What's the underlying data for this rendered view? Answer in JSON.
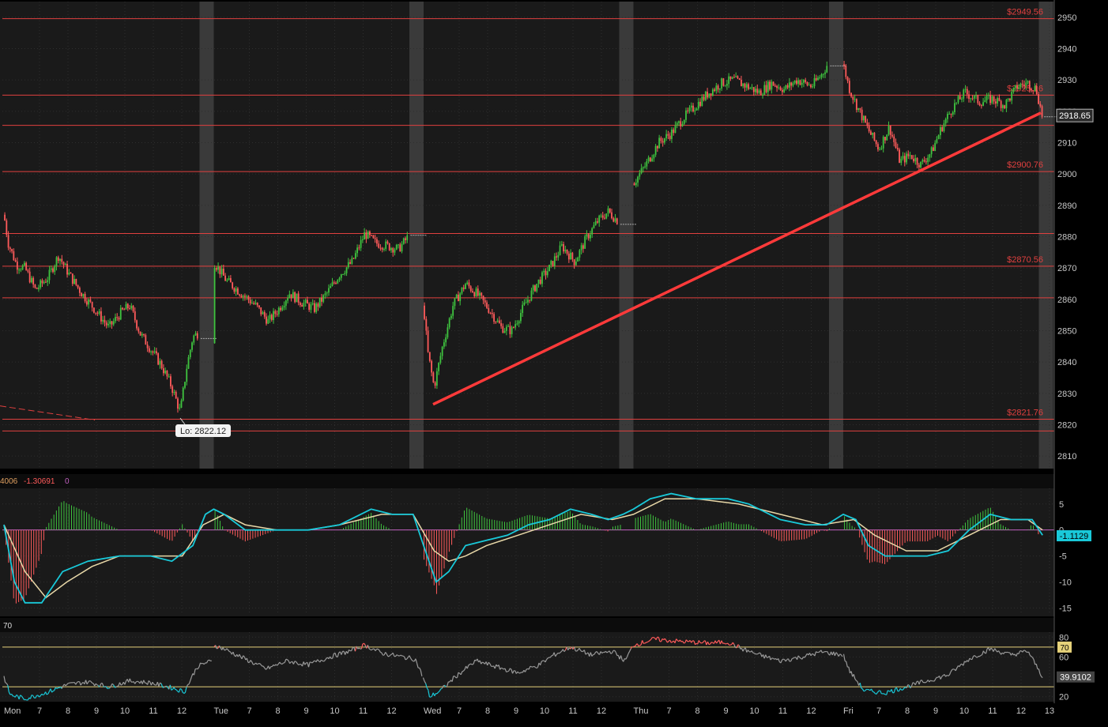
{
  "colors": {
    "background": "#000000",
    "panel": "#1a1a1a",
    "grid": "#2e2e2e",
    "session_shade": "#3a3a3a",
    "up_candle": "#3fc43f",
    "down_candle": "#ff5b5b",
    "level_line": "#e0403f",
    "trendline": "#ff3a3a",
    "axis_text": "#c8c8c8",
    "macd_fast": "#19c9d9",
    "macd_slow": "#e8d8a8",
    "rsi_line": "#9a9a9a",
    "rsi_hot": "#ff5b5b",
    "rsi_cold": "#19c9d9",
    "rsi_band": "#e6d27a"
  },
  "chart_data": [
    {
      "type": "candlestick",
      "panel": "price",
      "ylim": [
        2806,
        2955
      ],
      "y_ticks": [
        2810,
        2820,
        2830,
        2840,
        2850,
        2860,
        2870,
        2880,
        2890,
        2900,
        2910,
        2920,
        2930,
        2940,
        2950
      ],
      "last_price": "2918.65",
      "sessions": [
        {
          "day": "Mon",
          "hours": [
            "7",
            "8",
            "9",
            "10",
            "11",
            "12"
          ]
        },
        {
          "day": "Tue",
          "hours": [
            "7",
            "8",
            "9",
            "10",
            "11",
            "12"
          ]
        },
        {
          "day": "Wed",
          "hours": [
            "7",
            "8",
            "9",
            "10",
            "11",
            "12"
          ]
        },
        {
          "day": "Thu",
          "hours": [
            "7",
            "8",
            "9",
            "10",
            "11",
            "12"
          ]
        },
        {
          "day": "Fri",
          "hours": [
            "7",
            "8",
            "9",
            "10",
            "11",
            "12",
            "13"
          ]
        }
      ],
      "levels": [
        {
          "value": 2949.56,
          "label": "$2949.56"
        },
        {
          "value": 2925.16,
          "label": "$2925.16"
        },
        {
          "value": 2915.5,
          "label": ""
        },
        {
          "value": 2900.76,
          "label": "$2900.76"
        },
        {
          "value": 2881.0,
          "label": ""
        },
        {
          "value": 2870.56,
          "label": "$2870.56"
        },
        {
          "value": 2860.5,
          "label": ""
        },
        {
          "value": 2821.76,
          "label": "$2821.76"
        },
        {
          "value": 2818.0,
          "label": ""
        }
      ],
      "annotation": {
        "label": "Lo: 2822.12",
        "value": 2822.12
      },
      "trendline": {
        "from": {
          "session": "Wed",
          "value": 2826.5
        },
        "to": {
          "session": "Fri",
          "value": 2919.5
        }
      },
      "price_path": [
        [
          0,
          2887
        ],
        [
          0.02,
          2878
        ],
        [
          0.06,
          2871
        ],
        [
          0.1,
          2870
        ],
        [
          0.15,
          2863
        ],
        [
          0.21,
          2867
        ],
        [
          0.26,
          2874
        ],
        [
          0.31,
          2868
        ],
        [
          0.37,
          2862
        ],
        [
          0.43,
          2857
        ],
        [
          0.5,
          2851
        ],
        [
          0.56,
          2856
        ],
        [
          0.6,
          2858
        ],
        [
          0.65,
          2849
        ],
        [
          0.7,
          2844
        ],
        [
          0.75,
          2839
        ],
        [
          0.8,
          2832
        ],
        [
          0.84,
          2824
        ],
        [
          0.87,
          2838
        ],
        [
          0.9,
          2848
        ],
        [
          0.94,
          2850
        ],
        [
          1.0,
          2846
        ],
        [
          1.0,
          2872
        ],
        [
          1.06,
          2866
        ],
        [
          1.13,
          2862
        ],
        [
          1.2,
          2858
        ],
        [
          1.26,
          2853
        ],
        [
          1.31,
          2857
        ],
        [
          1.36,
          2862
        ],
        [
          1.42,
          2859
        ],
        [
          1.48,
          2857
        ],
        [
          1.54,
          2862
        ],
        [
          1.6,
          2868
        ],
        [
          1.66,
          2872
        ],
        [
          1.72,
          2881
        ],
        [
          1.77,
          2878
        ],
        [
          1.83,
          2877
        ],
        [
          1.88,
          2876
        ],
        [
          1.95,
          2882
        ],
        [
          2.0,
          2858
        ],
        [
          2.02,
          2843
        ],
        [
          2.05,
          2832
        ],
        [
          2.09,
          2845
        ],
        [
          2.14,
          2858
        ],
        [
          2.2,
          2865
        ],
        [
          2.25,
          2862
        ],
        [
          2.31,
          2857
        ],
        [
          2.37,
          2851
        ],
        [
          2.42,
          2850
        ],
        [
          2.48,
          2858
        ],
        [
          2.54,
          2865
        ],
        [
          2.6,
          2870
        ],
        [
          2.66,
          2877
        ],
        [
          2.72,
          2872
        ],
        [
          2.78,
          2880
        ],
        [
          2.83,
          2885
        ],
        [
          2.88,
          2888
        ],
        [
          2.94,
          2884
        ],
        [
          3.0,
          2897
        ],
        [
          3.06,
          2903
        ],
        [
          3.12,
          2910
        ],
        [
          3.18,
          2913
        ],
        [
          3.24,
          2918
        ],
        [
          3.3,
          2922
        ],
        [
          3.36,
          2926
        ],
        [
          3.42,
          2929
        ],
        [
          3.48,
          2930
        ],
        [
          3.54,
          2928
        ],
        [
          3.6,
          2926
        ],
        [
          3.66,
          2929
        ],
        [
          3.72,
          2927
        ],
        [
          3.78,
          2930
        ],
        [
          3.85,
          2928
        ],
        [
          3.9,
          2932
        ],
        [
          3.95,
          2938
        ],
        [
          4.0,
          2935
        ],
        [
          4.03,
          2927
        ],
        [
          4.07,
          2921
        ],
        [
          4.12,
          2914
        ],
        [
          4.17,
          2908
        ],
        [
          4.22,
          2915
        ],
        [
          4.27,
          2904
        ],
        [
          4.32,
          2906
        ],
        [
          4.37,
          2903
        ],
        [
          4.42,
          2907
        ],
        [
          4.47,
          2915
        ],
        [
          4.52,
          2921
        ],
        [
          4.58,
          2926
        ],
        [
          4.65,
          2923
        ],
        [
          4.71,
          2924
        ],
        [
          4.77,
          2922
        ],
        [
          4.83,
          2928
        ],
        [
          4.88,
          2929
        ],
        [
          4.92,
          2927
        ],
        [
          4.95,
          2918
        ]
      ]
    },
    {
      "type": "line",
      "panel": "macd",
      "header_values": [
        "4006",
        "-1.30691",
        "0"
      ],
      "ylim": [
        -16,
        8
      ],
      "y_ticks": [
        5,
        0,
        -5,
        -10,
        -15
      ],
      "last_value": "-1.1129",
      "fast": [
        [
          0,
          1
        ],
        [
          0.05,
          -10
        ],
        [
          0.1,
          -14
        ],
        [
          0.18,
          -14
        ],
        [
          0.28,
          -8
        ],
        [
          0.4,
          -6
        ],
        [
          0.55,
          -5
        ],
        [
          0.7,
          -5
        ],
        [
          0.8,
          -6
        ],
        [
          0.9,
          -3
        ],
        [
          0.96,
          3
        ],
        [
          1.0,
          4
        ],
        [
          1.05,
          3
        ],
        [
          1.15,
          0
        ],
        [
          1.3,
          0
        ],
        [
          1.45,
          0
        ],
        [
          1.6,
          1
        ],
        [
          1.75,
          4
        ],
        [
          1.85,
          3
        ],
        [
          1.95,
          3
        ],
        [
          2.0,
          -3
        ],
        [
          2.06,
          -10
        ],
        [
          2.12,
          -8
        ],
        [
          2.2,
          -3
        ],
        [
          2.3,
          -2
        ],
        [
          2.4,
          -1
        ],
        [
          2.5,
          1
        ],
        [
          2.6,
          2
        ],
        [
          2.7,
          4
        ],
        [
          2.8,
          3
        ],
        [
          2.88,
          2
        ],
        [
          2.95,
          3
        ],
        [
          3.0,
          4
        ],
        [
          3.08,
          6
        ],
        [
          3.18,
          7
        ],
        [
          3.3,
          6
        ],
        [
          3.45,
          6
        ],
        [
          3.55,
          5
        ],
        [
          3.7,
          2
        ],
        [
          3.82,
          1
        ],
        [
          3.92,
          1
        ],
        [
          4.0,
          3
        ],
        [
          4.06,
          2
        ],
        [
          4.12,
          -3
        ],
        [
          4.2,
          -5
        ],
        [
          4.3,
          -5
        ],
        [
          4.4,
          -5
        ],
        [
          4.5,
          -4
        ],
        [
          4.6,
          0
        ],
        [
          4.7,
          3
        ],
        [
          4.8,
          2
        ],
        [
          4.9,
          2
        ],
        [
          4.95,
          -1
        ]
      ],
      "slow": [
        [
          0,
          1
        ],
        [
          0.1,
          -8
        ],
        [
          0.2,
          -13
        ],
        [
          0.3,
          -10
        ],
        [
          0.42,
          -7
        ],
        [
          0.55,
          -5
        ],
        [
          0.7,
          -5
        ],
        [
          0.85,
          -5
        ],
        [
          0.95,
          1
        ],
        [
          1.05,
          3
        ],
        [
          1.15,
          1
        ],
        [
          1.3,
          0
        ],
        [
          1.45,
          0
        ],
        [
          1.6,
          1
        ],
        [
          1.8,
          3
        ],
        [
          1.95,
          3
        ],
        [
          2.05,
          -4
        ],
        [
          2.12,
          -6
        ],
        [
          2.2,
          -5
        ],
        [
          2.3,
          -3
        ],
        [
          2.45,
          -1
        ],
        [
          2.6,
          1
        ],
        [
          2.75,
          3
        ],
        [
          2.9,
          2
        ],
        [
          3.0,
          3
        ],
        [
          3.15,
          6
        ],
        [
          3.3,
          6
        ],
        [
          3.5,
          5
        ],
        [
          3.7,
          3
        ],
        [
          3.9,
          1
        ],
        [
          4.05,
          2
        ],
        [
          4.15,
          -1
        ],
        [
          4.3,
          -4
        ],
        [
          4.45,
          -4
        ],
        [
          4.6,
          -1
        ],
        [
          4.75,
          2
        ],
        [
          4.88,
          2
        ],
        [
          4.95,
          0
        ]
      ],
      "histogram_note": "green above zero, red below"
    },
    {
      "type": "line",
      "panel": "rsi",
      "header_values": [
        "70"
      ],
      "ylim": [
        15,
        85
      ],
      "y_ticks": [
        80,
        60,
        20
      ],
      "bands": [
        70,
        30
      ],
      "band_label": "70",
      "last_value": "39.9102",
      "values": [
        [
          0,
          40
        ],
        [
          0.03,
          22
        ],
        [
          0.1,
          18
        ],
        [
          0.2,
          24
        ],
        [
          0.3,
          32
        ],
        [
          0.4,
          35
        ],
        [
          0.5,
          30
        ],
        [
          0.6,
          36
        ],
        [
          0.7,
          34
        ],
        [
          0.8,
          29
        ],
        [
          0.86,
          25
        ],
        [
          0.92,
          50
        ],
        [
          0.97,
          55
        ],
        [
          1.0,
          55
        ],
        [
          1.0,
          72
        ],
        [
          1.05,
          68
        ],
        [
          1.15,
          58
        ],
        [
          1.25,
          48
        ],
        [
          1.35,
          56
        ],
        [
          1.45,
          52
        ],
        [
          1.55,
          60
        ],
        [
          1.65,
          66
        ],
        [
          1.72,
          72
        ],
        [
          1.8,
          64
        ],
        [
          1.9,
          60
        ],
        [
          1.96,
          58
        ],
        [
          2.0,
          38
        ],
        [
          2.03,
          20
        ],
        [
          2.08,
          26
        ],
        [
          2.15,
          40
        ],
        [
          2.25,
          56
        ],
        [
          2.35,
          50
        ],
        [
          2.45,
          44
        ],
        [
          2.55,
          52
        ],
        [
          2.62,
          62
        ],
        [
          2.7,
          70
        ],
        [
          2.8,
          62
        ],
        [
          2.9,
          66
        ],
        [
          2.96,
          56
        ],
        [
          3.0,
          72
        ],
        [
          3.1,
          78
        ],
        [
          3.2,
          76
        ],
        [
          3.35,
          74
        ],
        [
          3.45,
          75
        ],
        [
          3.52,
          68
        ],
        [
          3.6,
          62
        ],
        [
          3.7,
          56
        ],
        [
          3.8,
          60
        ],
        [
          3.9,
          65
        ],
        [
          4.0,
          62
        ],
        [
          4.03,
          46
        ],
        [
          4.1,
          26
        ],
        [
          4.2,
          24
        ],
        [
          4.3,
          30
        ],
        [
          4.4,
          36
        ],
        [
          4.5,
          42
        ],
        [
          4.6,
          58
        ],
        [
          4.7,
          68
        ],
        [
          4.8,
          62
        ],
        [
          4.88,
          66
        ],
        [
          4.95,
          40
        ]
      ]
    }
  ]
}
